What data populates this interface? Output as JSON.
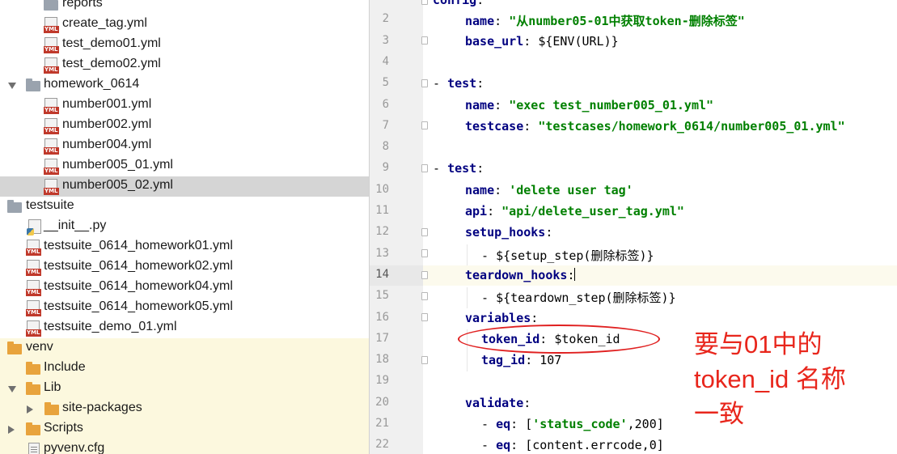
{
  "project_tree": {
    "items": [
      {
        "label": "reports",
        "icon": "folder-gray-icon"
      },
      {
        "label": "create_tag.yml",
        "icon": "yml-file-icon"
      },
      {
        "label": "test_demo01.yml",
        "icon": "yml-file-icon"
      },
      {
        "label": "test_demo02.yml",
        "icon": "yml-file-icon"
      },
      {
        "label": "homework_0614",
        "icon": "folder-gray-icon"
      },
      {
        "label": "number001.yml",
        "icon": "yml-file-icon"
      },
      {
        "label": "number002.yml",
        "icon": "yml-file-icon"
      },
      {
        "label": "number004.yml",
        "icon": "yml-file-icon"
      },
      {
        "label": "number005_01.yml",
        "icon": "yml-file-icon"
      },
      {
        "label": "number005_02.yml",
        "icon": "yml-file-icon",
        "selected": true
      },
      {
        "label": "testsuite",
        "icon": "folder-gray-icon"
      },
      {
        "label": "__init__.py",
        "icon": "python-file-icon"
      },
      {
        "label": "testsuite_0614_homework01.yml",
        "icon": "yml-file-icon"
      },
      {
        "label": "testsuite_0614_homework02.yml",
        "icon": "yml-file-icon"
      },
      {
        "label": "testsuite_0614_homework04.yml",
        "icon": "yml-file-icon"
      },
      {
        "label": "testsuite_0614_homework05.yml",
        "icon": "yml-file-icon"
      },
      {
        "label": "testsuite_demo_01.yml",
        "icon": "yml-file-icon"
      },
      {
        "label": "venv",
        "icon": "folder-orange-icon"
      },
      {
        "label": "Include",
        "icon": "folder-orange-icon"
      },
      {
        "label": "Lib",
        "icon": "folder-orange-icon"
      },
      {
        "label": "site-packages",
        "icon": "folder-orange-icon"
      },
      {
        "label": "Scripts",
        "icon": "folder-orange-icon"
      },
      {
        "label": "pyvenv.cfg",
        "icon": "cfg-file-icon"
      }
    ]
  },
  "editor": {
    "line_numbers": [
      "2",
      "3",
      "4",
      "5",
      "6",
      "7",
      "8",
      "9",
      "10",
      "11",
      "12",
      "13",
      "14",
      "15",
      "16",
      "17",
      "18",
      "19",
      "20",
      "21",
      "22"
    ],
    "current_line": "14",
    "lines": {
      "l1": {
        "key": "config",
        "punct": ":"
      },
      "l2": {
        "key": "name",
        "sep": ": ",
        "value": "\"从number05-01中获取token-删除标签\""
      },
      "l3": {
        "key": "base_url",
        "sep": ": ",
        "value": "${ENV(URL)}"
      },
      "l5": {
        "dash": "- ",
        "key": "test",
        "punct": ":"
      },
      "l6": {
        "key": "name",
        "sep": ": ",
        "value": "\"exec test_number005_01.yml\""
      },
      "l7": {
        "key": "testcase",
        "sep": ": ",
        "value": "\"testcases/homework_0614/number005_01.yml\""
      },
      "l9": {
        "dash": "- ",
        "key": "test",
        "punct": ":"
      },
      "l10": {
        "key": "name",
        "sep": ": ",
        "value": "'delete user tag'"
      },
      "l11": {
        "key": "api",
        "sep": ": ",
        "value": "\"api/delete_user_tag.yml\""
      },
      "l12": {
        "key": "setup_hooks",
        "punct": ":"
      },
      "l13": {
        "dash": "- ",
        "value": "${setup_step(删除标签)}"
      },
      "l14": {
        "key": "teardown_hooks",
        "punct": ":"
      },
      "l15": {
        "dash": "- ",
        "value": "${teardown_step(删除标签)}"
      },
      "l16": {
        "key": "variables",
        "punct": ":"
      },
      "l17": {
        "key": "token_id",
        "sep": ": ",
        "value": "$token_id"
      },
      "l18": {
        "key": "tag_id",
        "sep": ": ",
        "value": "107"
      },
      "l20": {
        "key": "validate",
        "punct": ":"
      },
      "l21": {
        "dash": "- ",
        "key": "eq",
        "sep": ": ",
        "pre": "[",
        "value": "'status_code'",
        "post": ",200]"
      },
      "l22": {
        "dash": "- ",
        "key": "eq",
        "sep": ": ",
        "value": "[content.errcode,0]"
      }
    }
  },
  "annotation": {
    "line1": "要与01中的",
    "line2": "token_id 名称",
    "line3": "一致",
    "color": "#e8261c"
  }
}
